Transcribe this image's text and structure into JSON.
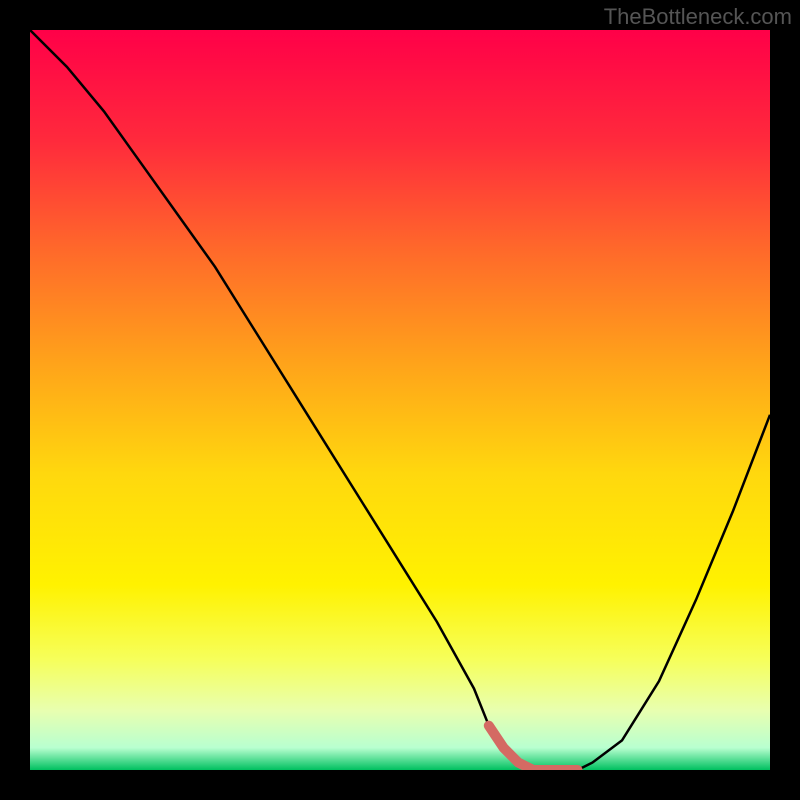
{
  "watermark": "TheBottleneck.com",
  "chart_data": {
    "type": "line",
    "title": "",
    "xlabel": "",
    "ylabel": "",
    "xlim": [
      0,
      100
    ],
    "ylim": [
      0,
      100
    ],
    "x": [
      0,
      5,
      10,
      15,
      20,
      25,
      30,
      35,
      40,
      45,
      50,
      55,
      60,
      62,
      64,
      66,
      68,
      70,
      72,
      74,
      76,
      80,
      85,
      90,
      95,
      100
    ],
    "values": [
      100,
      95,
      89,
      82,
      75,
      68,
      60,
      52,
      44,
      36,
      28,
      20,
      11,
      6,
      3,
      1,
      0,
      0,
      0,
      0,
      1,
      4,
      12,
      23,
      35,
      48
    ],
    "gradient": {
      "stops": [
        {
          "pos": 0.0,
          "color": "#ff0048"
        },
        {
          "pos": 0.15,
          "color": "#ff2a3c"
        },
        {
          "pos": 0.3,
          "color": "#ff6a2a"
        },
        {
          "pos": 0.45,
          "color": "#ffa31a"
        },
        {
          "pos": 0.6,
          "color": "#ffd80e"
        },
        {
          "pos": 0.75,
          "color": "#fff200"
        },
        {
          "pos": 0.85,
          "color": "#f6ff5a"
        },
        {
          "pos": 0.92,
          "color": "#e8ffb0"
        },
        {
          "pos": 0.97,
          "color": "#b8ffd0"
        },
        {
          "pos": 1.0,
          "color": "#00c060"
        }
      ]
    },
    "highlight": {
      "color": "#d46a63",
      "x_start": 62,
      "x_end": 74
    }
  }
}
